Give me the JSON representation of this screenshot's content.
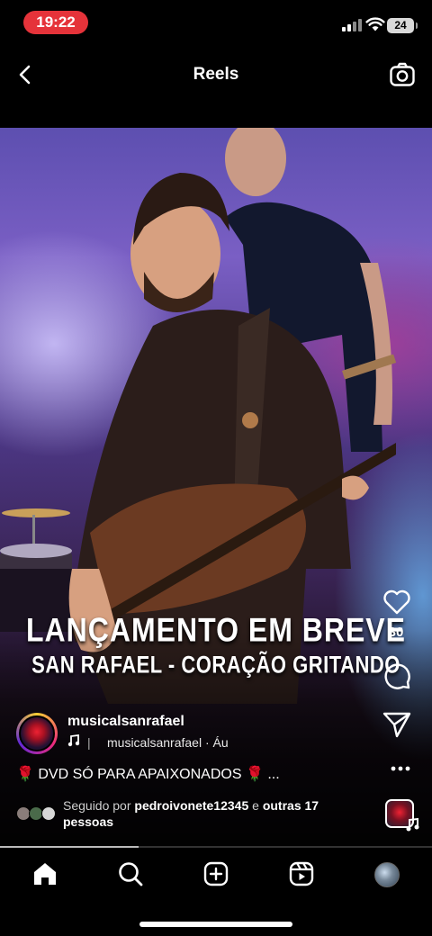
{
  "status_bar": {
    "time": "19:22",
    "battery": "24"
  },
  "header": {
    "title": "Reels"
  },
  "video": {
    "caption_line1": "LANÇAMENTO EM BREVE",
    "caption_line2": "SAN RAFAEL - CORAÇÃO GRITANDO"
  },
  "actions": {
    "like_count": "30"
  },
  "post": {
    "username": "musicalsanrafael",
    "audio_label": "musicalsanrafael · Áu",
    "caption": "DVD SÓ PARA APAIXONADOS",
    "caption_suffix": "...",
    "followed_by_prefix": "Seguido por",
    "followed_by_user": "pedroivonete12345",
    "followed_by_middle": "e",
    "followed_by_others": "outras 17",
    "followed_by_suffix": "pessoas"
  },
  "icons": {
    "back": "chevron-left-icon",
    "camera": "camera-icon",
    "like": "heart-icon",
    "comment": "comment-icon",
    "share": "send-icon",
    "more": "more-dots-icon",
    "music": "music-note-icon",
    "nav": [
      "home-icon",
      "search-icon",
      "create-icon",
      "reels-icon",
      "profile-avatar"
    ]
  },
  "playback_progress": 0.32,
  "colors": {
    "time_pill": "#e5333a",
    "background": "#000000",
    "rose": "#e22222"
  }
}
